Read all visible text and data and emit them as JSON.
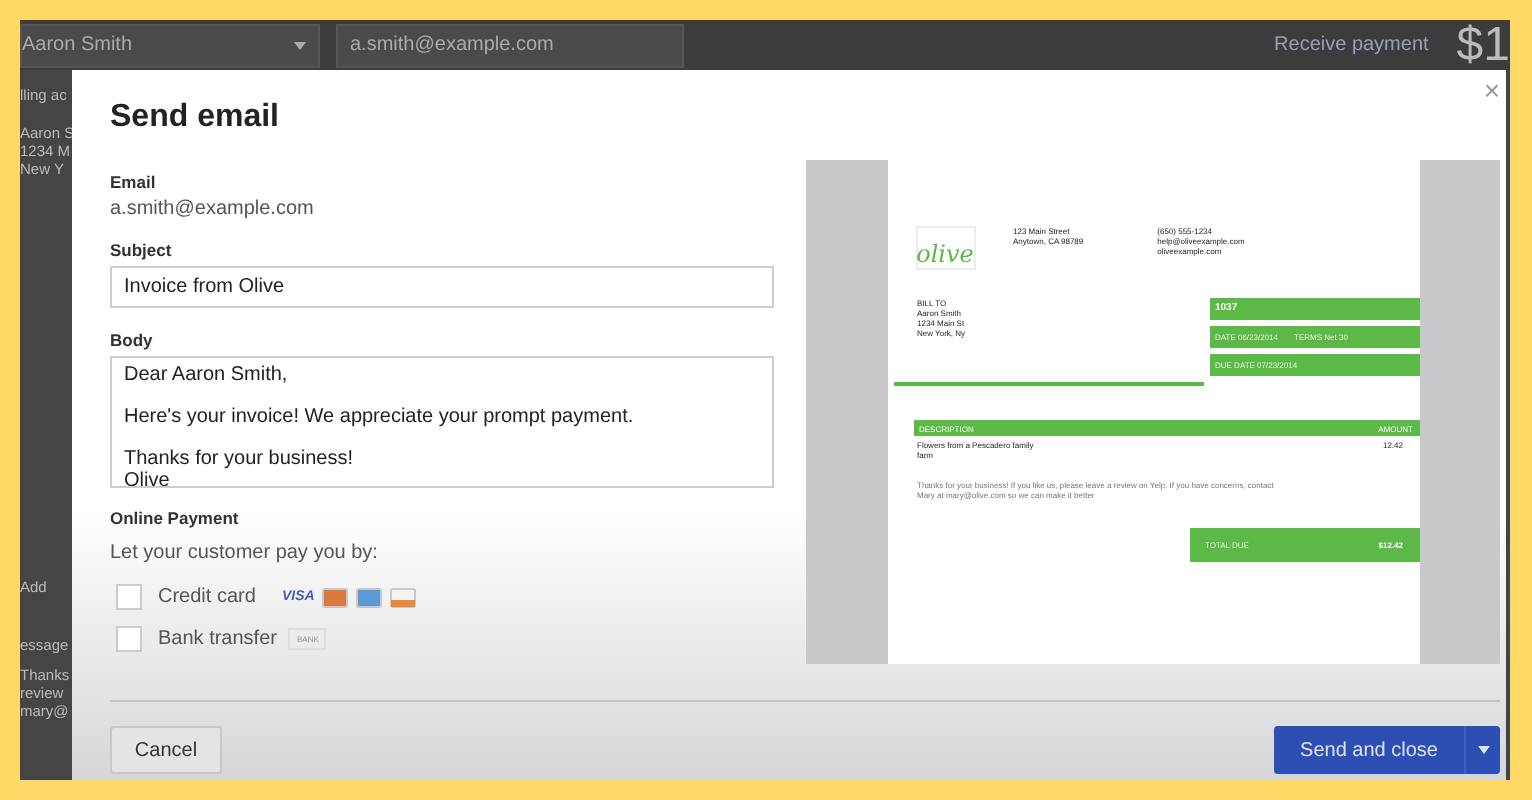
{
  "background_page": {
    "customer": "Aaron Smith",
    "email": "a.smith@example.com",
    "receive_payment": "Receive payment",
    "balance": "$1",
    "side_texts": [
      "lling ac",
      "Aaron S",
      "1234 M",
      "New Y"
    ],
    "add_label": "Add",
    "lower_texts": [
      "essage",
      "Thanks",
      "review",
      "mary@"
    ]
  },
  "dialog": {
    "title": "Send email",
    "email": {
      "label": "Email",
      "value": "a.smith@example.com"
    },
    "subject": {
      "label": "Subject",
      "value": "Invoice from Olive"
    },
    "body": {
      "label": "Body",
      "value": "Dear Aaron Smith,\n\nHere's your invoice! We appreciate your prompt payment.\n\nThanks for your business!\nOlive"
    },
    "online_payment": {
      "label": "Online Payment",
      "prompt": "Let your customer pay you by:",
      "options": [
        {
          "label": "Credit card",
          "checked": false,
          "kind": "card"
        },
        {
          "label": "Bank transfer",
          "checked": false,
          "kind": "bank"
        }
      ],
      "card_logo_text": "VISA",
      "bank_logo_text": "BANK"
    },
    "invoice": {
      "logo": "olive",
      "address": [
        "123 Main Street",
        "Anytown, CA 98789"
      ],
      "contact": [
        "(650) 555-1234",
        "help@oliveexample.com",
        "oliveexample.com"
      ],
      "bill_to_label": "BILL TO",
      "bill_to": [
        "Aaron Smith",
        "1234 Main St",
        "New York, Ny"
      ],
      "number": "1037",
      "date": "DATE 06/23/2014",
      "terms": "TERMS Net 30",
      "due_date": "DUE DATE 07/23/2014",
      "columns": [
        "DESCRIPTION",
        "AMOUNT"
      ],
      "items": [
        {
          "description": "Flowers from a Pescadero family farm",
          "amount": "12.42"
        }
      ],
      "note": "Thanks for your business! If you like us, please leave a review on Yelp. If you have concerns, contact Mary at mary@olive.com so we can make it better",
      "total_label": "TOTAL DUE",
      "total": "$12.42"
    },
    "buttons": {
      "cancel": "Cancel",
      "send": "Send and close"
    },
    "close": "×"
  }
}
